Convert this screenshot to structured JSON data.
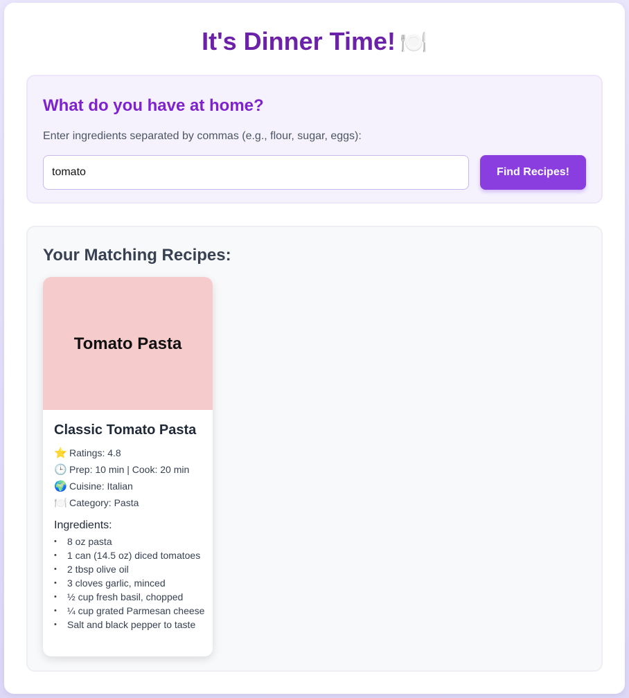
{
  "header": {
    "title": "It's Dinner Time!",
    "title_icon": "🍽️"
  },
  "search": {
    "heading": "What do you have at home?",
    "hint": "Enter ingredients separated by commas (e.g., flour, sugar, eggs):",
    "value": "tomato",
    "button_label": "Find Recipes!"
  },
  "results": {
    "heading": "Your Matching Recipes:",
    "recipes": [
      {
        "image_text": "Tomato Pasta",
        "title": "Classic Tomato Pasta",
        "meta": [
          {
            "icon": "⭐",
            "icon_name": "star-icon",
            "text": "Ratings: 4.8"
          },
          {
            "icon": "🕒",
            "icon_name": "clock-icon",
            "text": "Prep: 10 min | Cook: 20 min"
          },
          {
            "icon": "🌍",
            "icon_name": "globe-icon",
            "text": "Cuisine: Italian"
          },
          {
            "icon": "🍽️",
            "icon_name": "plate-icon",
            "text": "Category: Pasta"
          }
        ],
        "ingredients_heading": "Ingredients:",
        "ingredients": [
          "8 oz pasta",
          "1 can (14.5 oz) diced tomatoes",
          "2 tbsp olive oil",
          "3 cloves garlic, minced",
          "½ cup fresh basil, chopped",
          "¼ cup grated Parmesan cheese",
          "Salt and black pepper to taste"
        ]
      }
    ]
  },
  "colors": {
    "accent": "#8b3ee0",
    "title": "#6b21a8",
    "card_image": "#f5cccb"
  }
}
